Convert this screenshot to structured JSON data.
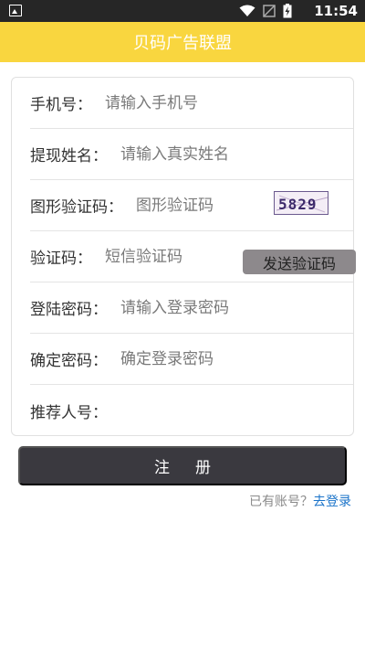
{
  "status_bar": {
    "time": "11:54"
  },
  "app_bar": {
    "title": "贝码广告联盟"
  },
  "form": {
    "phone": {
      "label": "手机号：",
      "placeholder": "请输入手机号"
    },
    "name": {
      "label": "提现姓名：",
      "placeholder": "请输入真实姓名"
    },
    "captcha": {
      "label": "图形验证码：",
      "placeholder": "图形验证码",
      "image_text": "5829"
    },
    "sms_code": {
      "label": "验证码：",
      "placeholder": "短信验证码",
      "send_label": "发送验证码"
    },
    "password": {
      "label": "登陆密码：",
      "placeholder": "请输入登录密码"
    },
    "confirm_password": {
      "label": "确定密码：",
      "placeholder": "确定登录密码"
    },
    "referrer": {
      "label": "推荐人号：",
      "placeholder": ""
    }
  },
  "actions": {
    "register_label": "注册",
    "login_question": "已有账号？",
    "login_link": "去登录"
  },
  "colors": {
    "app_bar": "#f9d63f",
    "register_button": "#3a393f",
    "send_button": "#8d898c",
    "link": "#1a73c9"
  }
}
